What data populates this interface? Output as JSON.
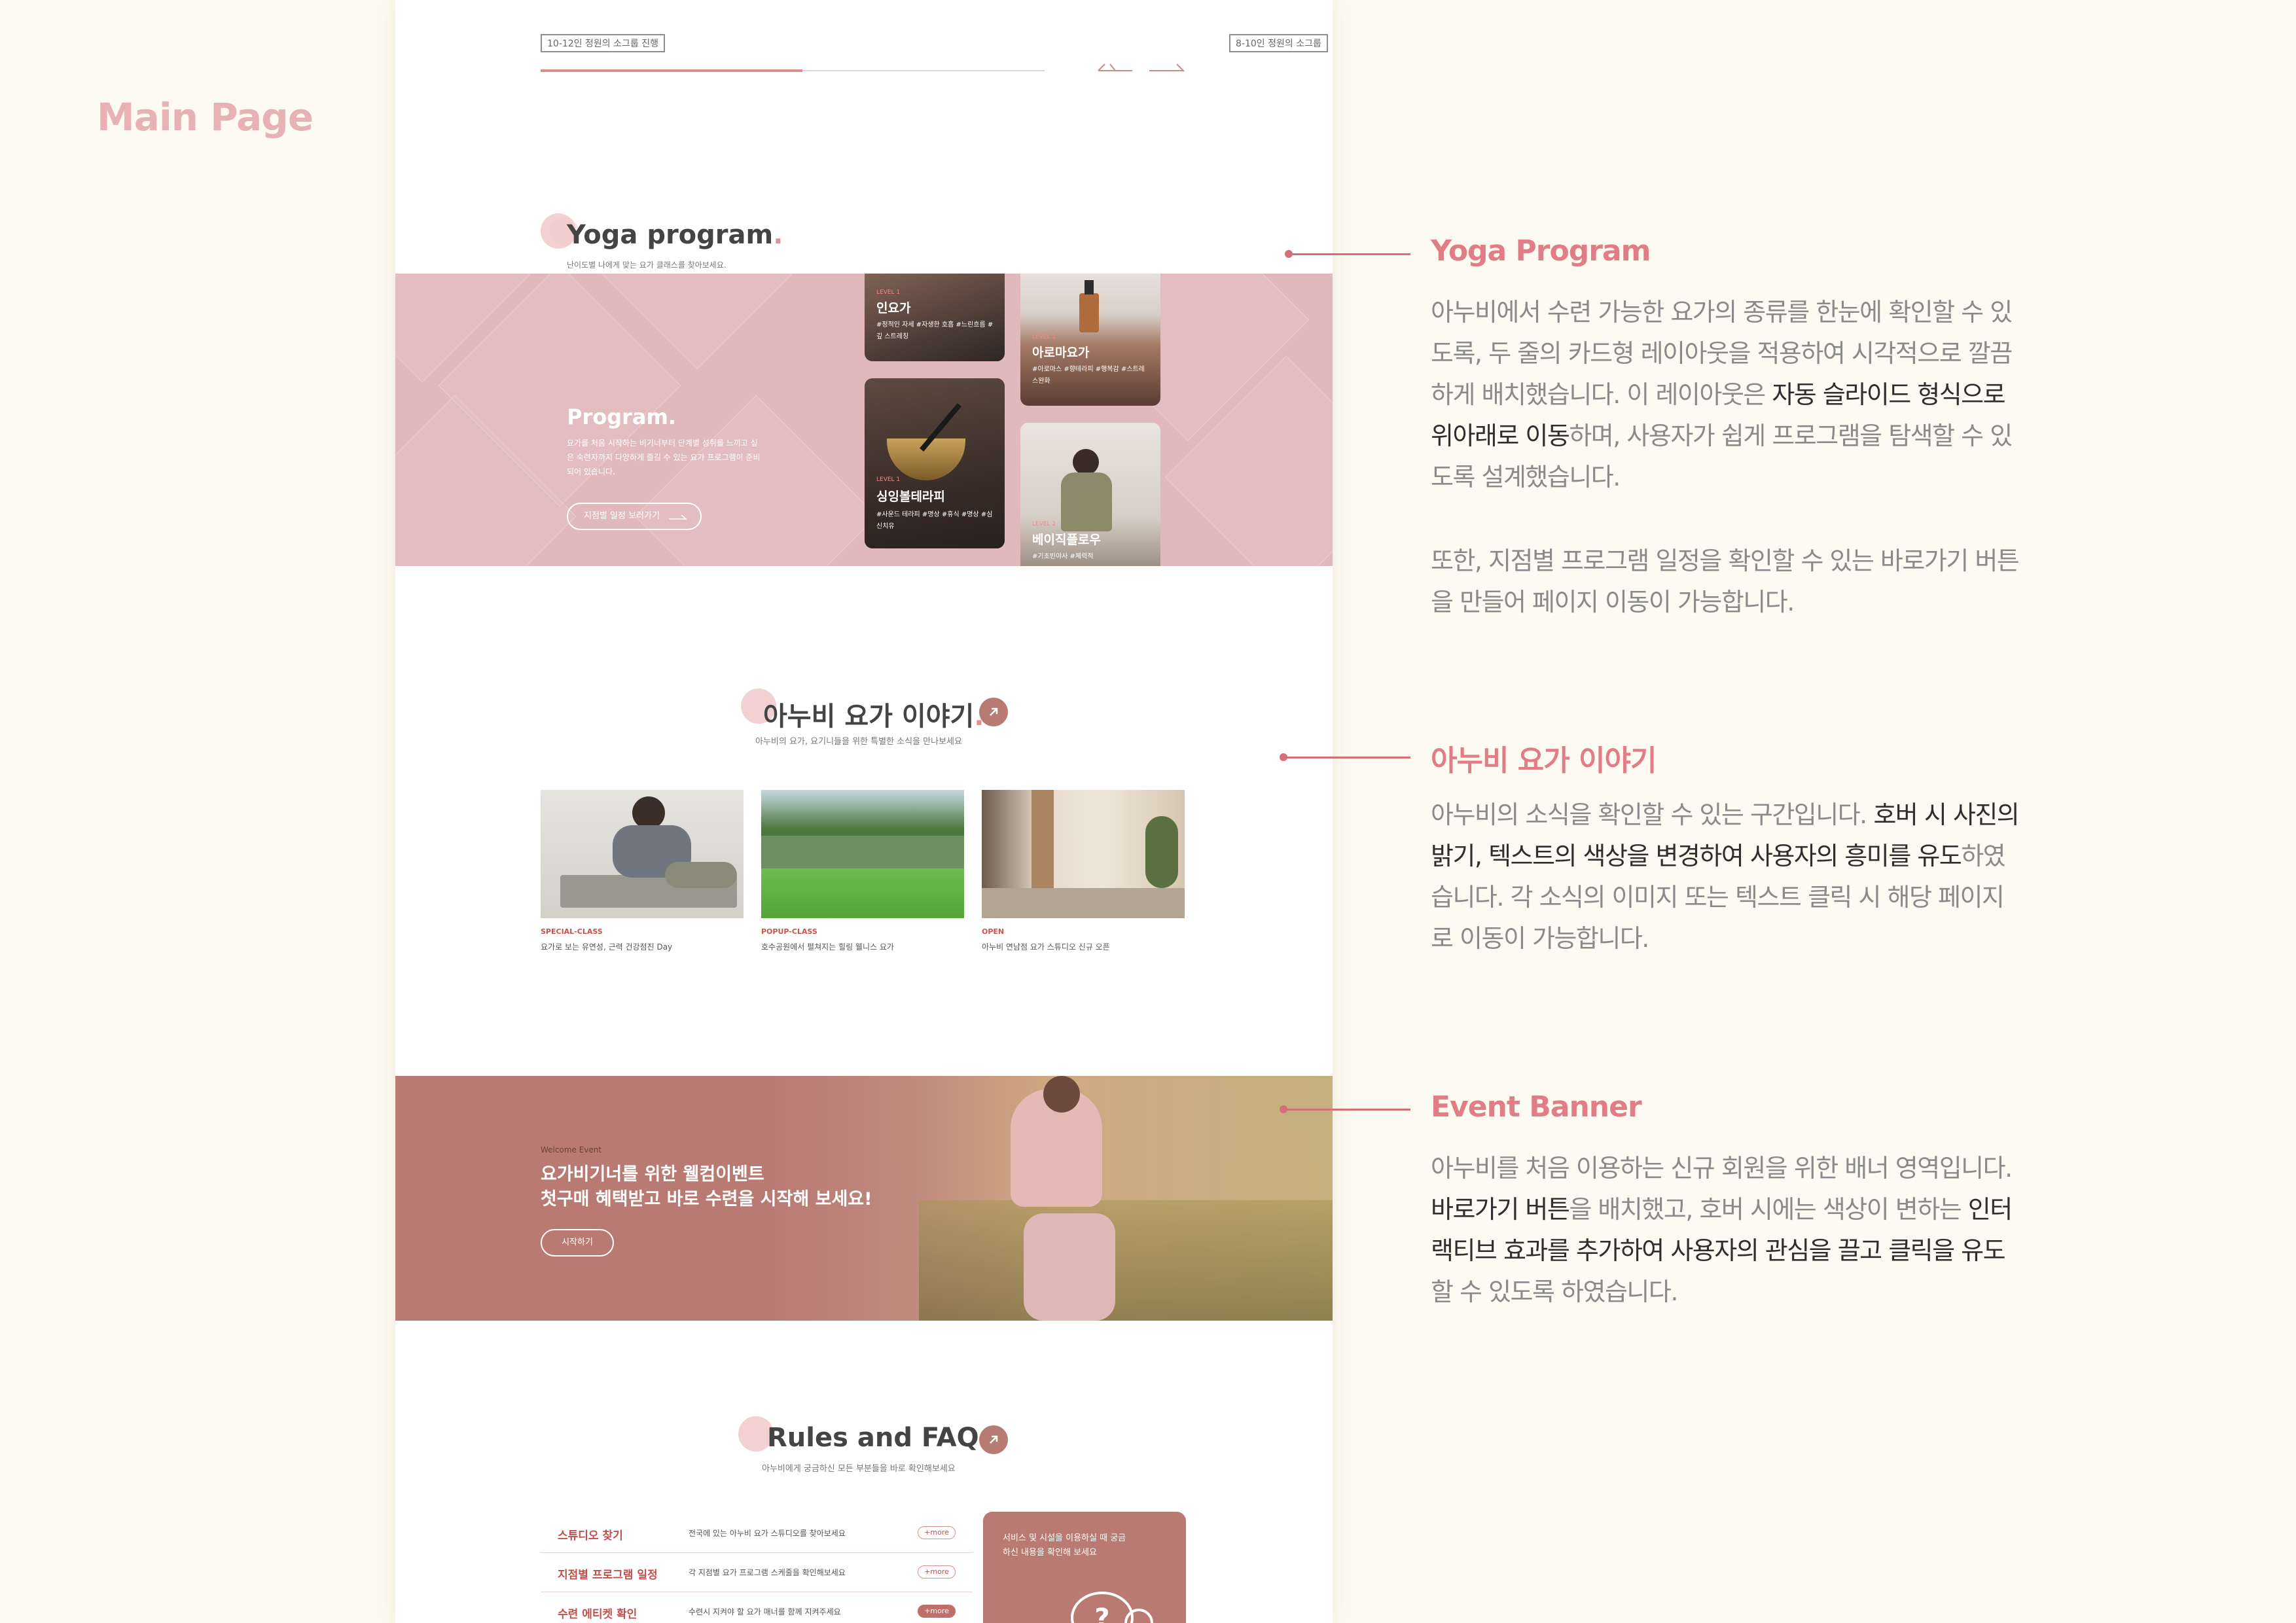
{
  "page_label": "Main Page",
  "slider": {
    "tag_left": "10-12인 정원의 소그룹 진행",
    "tag_right": "8-10인 정원의 소그룹",
    "progress": 0.52
  },
  "program_section": {
    "title": "Yoga program",
    "subtitle": "난이도별 나에게 맞는 요가 클래스를 찾아보세요.",
    "band_title": "Program.",
    "band_desc": "요가를 처음 시작하는 비기너부터 단계별 성취를 느끼고 싶은 숙련자까지 다양하게 즐길 수 있는 요가 프로그램이 준비되어 있습니다.",
    "band_button": "지점별 일정 보러가기",
    "cards": [
      {
        "name": "인요가",
        "level": "LEVEL 1",
        "tags": "#정적인 자세 #자생한 호흡 #느린흐름 #깊 스트레칭"
      },
      {
        "name": "아로마요가",
        "level": "LEVEL 1",
        "tags": "#아로마스 #향테라피 #행복감 #스트레스완화"
      },
      {
        "name": "싱잉볼테라피",
        "level": "LEVEL 1",
        "tags": "#사운드 테라피 #명상 #휴식 #명상 #심신치유"
      },
      {
        "name": "베이직플로우",
        "level": "LEVEL 2",
        "tags": "#기초빈야사 #체력적"
      }
    ]
  },
  "news_section": {
    "title": "아누비 요가 이야기",
    "subtitle": "아누비의 요가, 요기니들을 위한 특별한 소식을 만나보세요",
    "items": [
      {
        "category": "SPECIAL-CLASS",
        "text": "요가로 보는 유연성, 근력 건강점진 Day"
      },
      {
        "category": "POPUP-CLASS",
        "text": "호수공원에서 펼쳐지는 힐링 웰니스 요가"
      },
      {
        "category": "OPEN",
        "text": "아누비 연남점 요가 스튜디오 신규 오픈"
      }
    ]
  },
  "event_banner": {
    "small": "Welcome Event",
    "line1": "요가비기너를 위한 웰컴이벤트",
    "line2": "첫구매 혜택받고 바로 수련을 시작해 보세요!",
    "button": "시작하기"
  },
  "faq_section": {
    "title": "Rules and FAQs",
    "subtitle": "아누비에게 궁금하신 모든 부분들을 바로 확인해보세요",
    "rows": [
      {
        "q": "스튜디오 찾기",
        "a": "전국에 있는 아누비 요가 스튜디오를 찾아보세요",
        "more": "+more"
      },
      {
        "q": "지점별 프로그램 일정",
        "a": "각 지점별 요가 프로그램 스케줄을 확인해보세요",
        "more": "+more"
      },
      {
        "q": "수련 에티켓 확인",
        "a": "수련시 지켜야 할 요가 매너를 함께 지켜주세요",
        "more": "+more"
      }
    ],
    "card_text": "서비스 및 시설을 이용하실 때 궁금하신 내용을 확인해 보세요"
  },
  "annotations": [
    {
      "title": "Yoga Program",
      "p1_a": "아누비에서 수련 가능한 요가의 종류를 한눈에 확인할 수 있도록, 두 줄의 카드형 레이아웃을 적용하여 시각적으로 깔끔하게 배치했습니다. 이 레이아웃은 ",
      "p1_b": "자동 슬라이드 형식으로 위아래로 이동",
      "p1_c": "하며, 사용자가 쉽게 프로그램을 탐색할 수 있도록 설계했습니다.",
      "p2": "또한, 지점별 프로그램 일정을 확인할 수 있는 바로가기 버튼을 만들어 페이지 이동이 가능합니다."
    },
    {
      "title": "아누비 요가 이야기",
      "p1_a": "아누비의 소식을 확인할 수 있는 구간입니다. ",
      "p1_b": "호버 시 사진의 밝기, 텍스트의 색상을 변경하여 사용자의 흥미를 유도",
      "p1_c": "하였습니다. 각 소식의 이미지 또는 텍스트 클릭 시 해당 페이지로 이동이 가능합니다."
    },
    {
      "title": "Event Banner",
      "p1_a": "아누비를 처음 이용하는 신규 회원을 위한 배너 영역입니다. ",
      "p1_b": "바로가기 버튼",
      "p1_c": "을 배치했고, 호버 시에는 색상이 변하는 ",
      "p1_d": "인터랙티브 효과를 추가하여 사용자의 관심을 끌고 클릭을 유도",
      "p1_e": "할 수 있도록 하였습니다."
    }
  ],
  "colors": {
    "accent": "#e07d86",
    "band": "#e2b9bb",
    "event": "#b97a73",
    "bg": "#fdfbf1"
  }
}
